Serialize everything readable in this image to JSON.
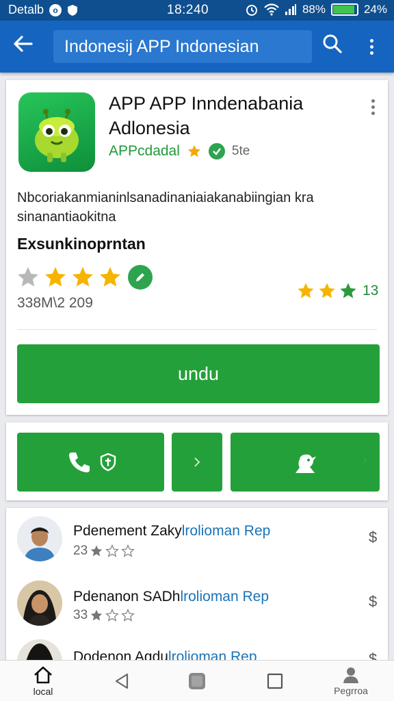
{
  "status_bar": {
    "left_text": "Detalb",
    "time": "18:240",
    "battery_text": "88%",
    "right_text": "24%"
  },
  "app_bar": {
    "search_text": "Indonesij APP Indonesian"
  },
  "app": {
    "title": "APP APP Inndenabania Adlonesia",
    "developer": "APPcdadal",
    "extra": "5te",
    "description": "Nbcoriakanmianinlsanadinaniaiakanabiingian kra sinanantiaokitna",
    "section_title": "Exsunkinoprntan",
    "rating_count": "338M\\2 209",
    "mini_rating_number": "13",
    "install_label": "undu"
  },
  "colors": {
    "primary_blue": "#1565c0",
    "accent_green": "#24a03a",
    "star_yellow": "#f6b400",
    "star_gray": "#b8b8b8"
  },
  "reviews": [
    {
      "name": "Pdenement Zaky",
      "highlight": "lrolioman Rep",
      "stars_text": "23",
      "dollar": "$"
    },
    {
      "name": "Pdenanon SADh",
      "highlight": "lrolioman Rep",
      "stars_text": "33",
      "dollar": "$"
    },
    {
      "name": "Dodenon Agdu",
      "highlight": "lrolioman Rep",
      "stars_text": "",
      "dollar": "$"
    }
  ],
  "bottom_nav": {
    "home_label": "local",
    "profile_label": "Pegrroa"
  }
}
